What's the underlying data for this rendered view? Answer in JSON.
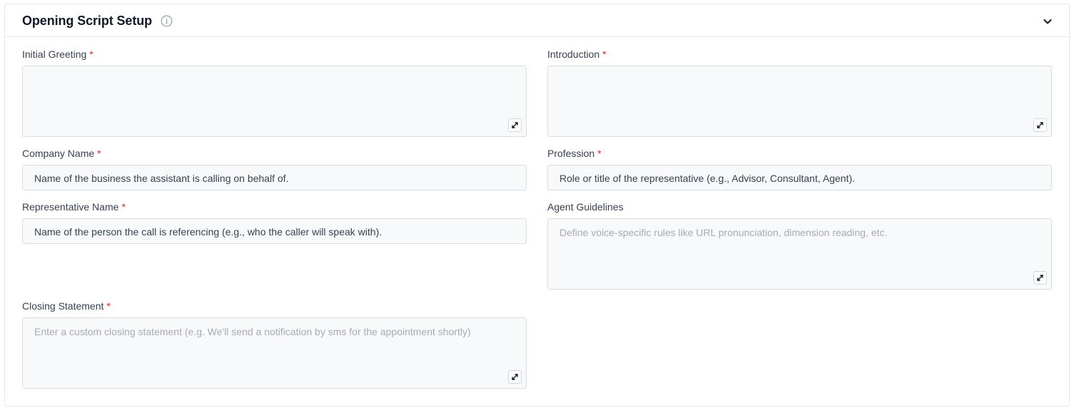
{
  "section": {
    "title": "Opening Script Setup"
  },
  "fields": {
    "initial_greeting": {
      "label": "Initial Greeting",
      "required_mark": "*",
      "value": ""
    },
    "introduction": {
      "label": "Introduction",
      "required_mark": "*",
      "value": ""
    },
    "company_name": {
      "label": "Company Name",
      "required_mark": "*",
      "value": "Name of the business the assistant is calling on behalf of."
    },
    "profession": {
      "label": "Profession",
      "required_mark": "*",
      "value": "Role or title of the representative (e.g., Advisor, Consultant, Agent)."
    },
    "representative_name": {
      "label": "Representative Name",
      "required_mark": "*",
      "value": "Name of the person the call is referencing (e.g., who the caller will speak with)."
    },
    "agent_guidelines": {
      "label": "Agent Guidelines",
      "placeholder": "Define voice-specific rules like URL pronunciation, dimension reading, etc."
    },
    "closing_statement": {
      "label": "Closing Statement",
      "required_mark": "*",
      "placeholder": "Enter a custom closing statement (e.g. We'll send a notification by sms for the appointment shortly)"
    }
  },
  "icons": {
    "info": "info-icon",
    "collapse": "chevron-down-icon",
    "expand": "expand-icon"
  },
  "colors": {
    "required": "#dc2626",
    "field_bg": "#f8f9fa",
    "border": "#d9dde3"
  }
}
